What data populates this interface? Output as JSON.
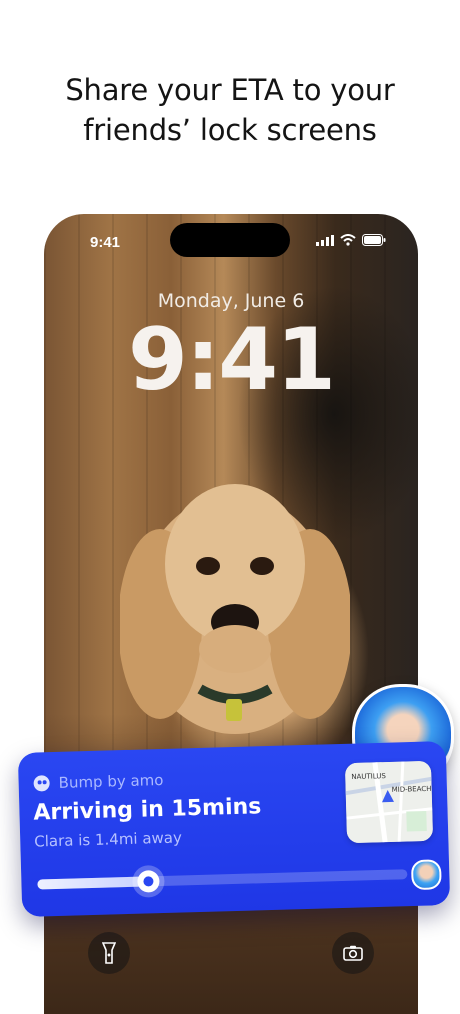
{
  "headline": {
    "line1": "Share your ETA to your",
    "line2": "friends’ lock screens"
  },
  "phone": {
    "status_time": "9:41",
    "date": "Monday, June 6",
    "clock": "9:41"
  },
  "live_activity": {
    "app_name": "Bump by amo",
    "arrival_text": "Arriving in 15mins",
    "distance_text": "Clara is 1.4mi away",
    "progress": 0.3,
    "map_labels": [
      "NAUTILUS",
      "MID-BEACH"
    ]
  },
  "colors": {
    "card_blue": "#2a47f2",
    "headline_text": "#141414"
  },
  "icons": {
    "flashlight": "flashlight-icon",
    "camera": "camera-icon",
    "signal": "signal-icon",
    "wifi": "wifi-icon",
    "battery": "battery-icon",
    "app_logo": "bump-logo-icon"
  }
}
